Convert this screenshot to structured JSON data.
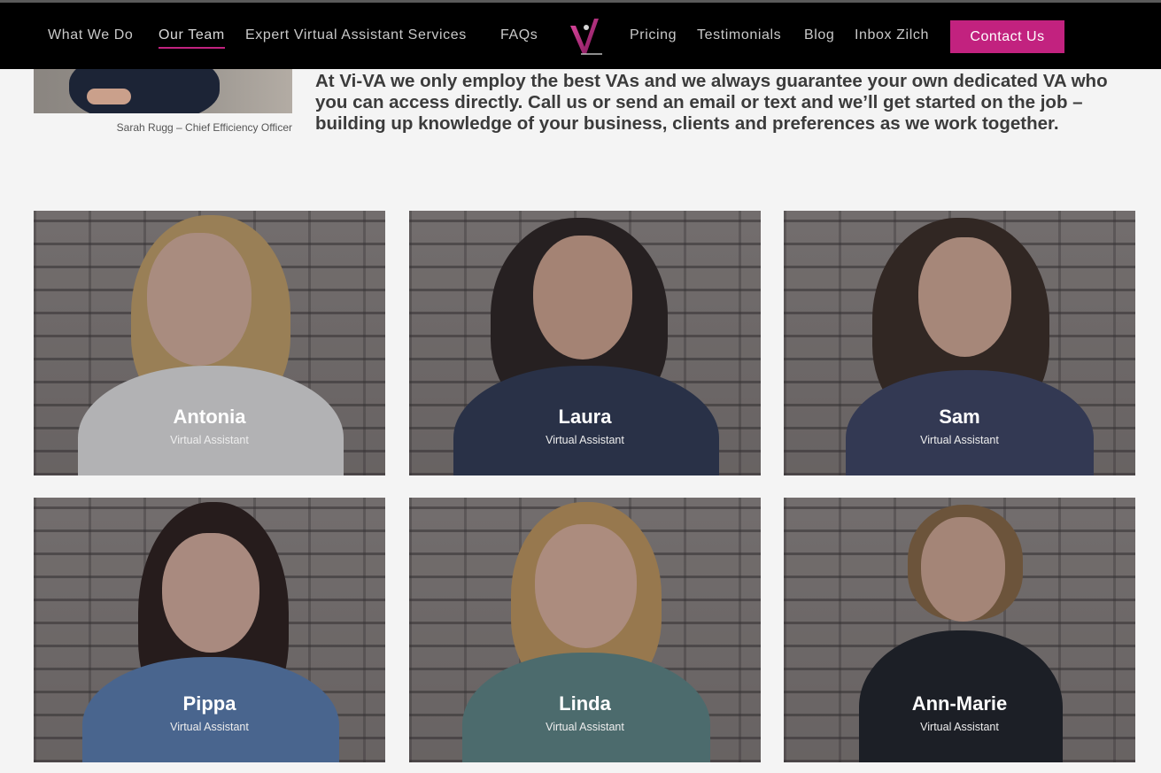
{
  "nav": {
    "items": [
      {
        "label": "What We Do"
      },
      {
        "label": "Our Team"
      },
      {
        "label": "Expert Virtual Assistant Services"
      },
      {
        "label": "FAQs"
      },
      {
        "label": "Pricing"
      },
      {
        "label": "Testimonials"
      },
      {
        "label": "Blog"
      },
      {
        "label": "Inbox Zilch"
      }
    ],
    "active": "Our Team",
    "contact_label": "Contact Us",
    "accent": "#c2227f"
  },
  "founder": {
    "caption": "Sarah Rugg – Chief Efficiency Officer"
  },
  "intro": {
    "text": "At Vi-VA we only employ the best VAs and we always guarantee your own dedicated VA who you can access directly. Call us or send an email or text and we’ll get started on the job – building up knowledge of your business, clients and preferences as we work together."
  },
  "team": [
    {
      "name": "Antonia",
      "role": "Virtual Assistant"
    },
    {
      "name": "Laura",
      "role": "Virtual Assistant"
    },
    {
      "name": "Sam",
      "role": "Virtual Assistant"
    },
    {
      "name": "Pippa",
      "role": "Virtual Assistant"
    },
    {
      "name": "Linda",
      "role": "Virtual Assistant"
    },
    {
      "name": "Ann-Marie",
      "role": "Virtual Assistant"
    }
  ]
}
